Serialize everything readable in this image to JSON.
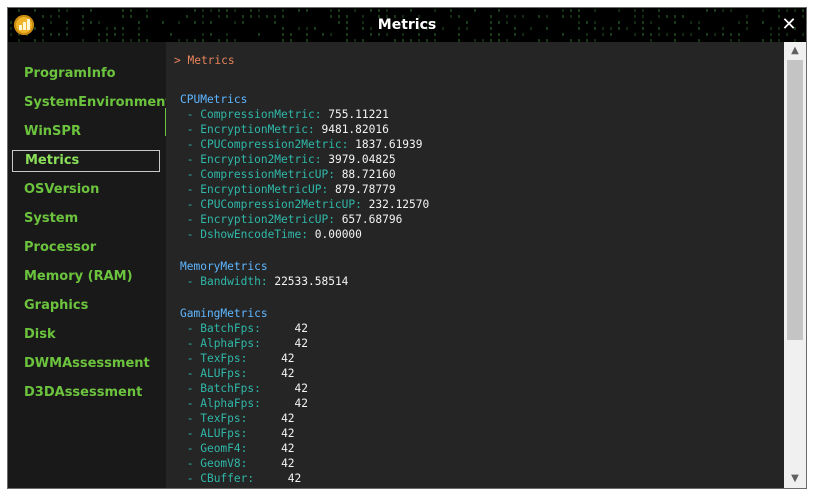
{
  "window": {
    "title": "Metrics"
  },
  "sidebar": {
    "items": [
      {
        "label": "ProgramInfo",
        "active": false
      },
      {
        "label": "SystemEnvironment",
        "active": false
      },
      {
        "label": "WinSPR",
        "active": false
      },
      {
        "label": "Metrics",
        "active": true
      },
      {
        "label": "OSVersion",
        "active": false
      },
      {
        "label": "System",
        "active": false
      },
      {
        "label": "Processor",
        "active": false
      },
      {
        "label": "Memory (RAM)",
        "active": false
      },
      {
        "label": "Graphics",
        "active": false
      },
      {
        "label": "Disk",
        "active": false
      },
      {
        "label": "DWMAssessment",
        "active": false
      },
      {
        "label": "D3DAssessment",
        "active": false
      }
    ]
  },
  "content": {
    "breadcrumb": "> Metrics",
    "sections": [
      {
        "title": "CPUMetrics",
        "rows": [
          {
            "key": "CompressionMetric:",
            "gap": " ",
            "value": "755.11221"
          },
          {
            "key": "EncryptionMetric:",
            "gap": " ",
            "value": "9481.82016"
          },
          {
            "key": "CPUCompression2Metric:",
            "gap": " ",
            "value": "1837.61939"
          },
          {
            "key": "Encryption2Metric:",
            "gap": " ",
            "value": "3979.04825"
          },
          {
            "key": "CompressionMetricUP:",
            "gap": " ",
            "value": "88.72160"
          },
          {
            "key": "EncryptionMetricUP:",
            "gap": " ",
            "value": "879.78779"
          },
          {
            "key": "CPUCompression2MetricUP:",
            "gap": " ",
            "value": "232.12570"
          },
          {
            "key": "Encryption2MetricUP:",
            "gap": " ",
            "value": "657.68796"
          },
          {
            "key": "DshowEncodeTime:",
            "gap": " ",
            "value": "0.00000"
          }
        ]
      },
      {
        "title": "MemoryMetrics",
        "rows": [
          {
            "key": "Bandwidth:",
            "gap": " ",
            "value": "22533.58514"
          }
        ]
      },
      {
        "title": "GamingMetrics",
        "rows": [
          {
            "key": "BatchFps:",
            "gap": "     ",
            "value": "42"
          },
          {
            "key": "AlphaFps:",
            "gap": "     ",
            "value": "42"
          },
          {
            "key": "TexFps:",
            "gap": "     ",
            "value": "42"
          },
          {
            "key": "ALUFps:",
            "gap": "     ",
            "value": "42"
          },
          {
            "key": "BatchFps:",
            "gap": "     ",
            "value": "42"
          },
          {
            "key": "AlphaFps:",
            "gap": "     ",
            "value": "42"
          },
          {
            "key": "TexFps:",
            "gap": "     ",
            "value": "42"
          },
          {
            "key": "ALUFps:",
            "gap": "     ",
            "value": "42"
          },
          {
            "key": "GeomF4:",
            "gap": "     ",
            "value": "42"
          },
          {
            "key": "GeomV8:",
            "gap": "     ",
            "value": "42"
          },
          {
            "key": "CBuffer:",
            "gap": "     ",
            "value": "42"
          }
        ]
      }
    ]
  },
  "scrollbar": {
    "up_icon": "chevron-up-icon",
    "down_icon": "chevron-down-icon"
  },
  "colors": {
    "accent_green": "#6cc33e",
    "key_teal": "#2fb8a8",
    "section_blue": "#5fb6ff",
    "breadcrumb_orange": "#e8845a"
  }
}
